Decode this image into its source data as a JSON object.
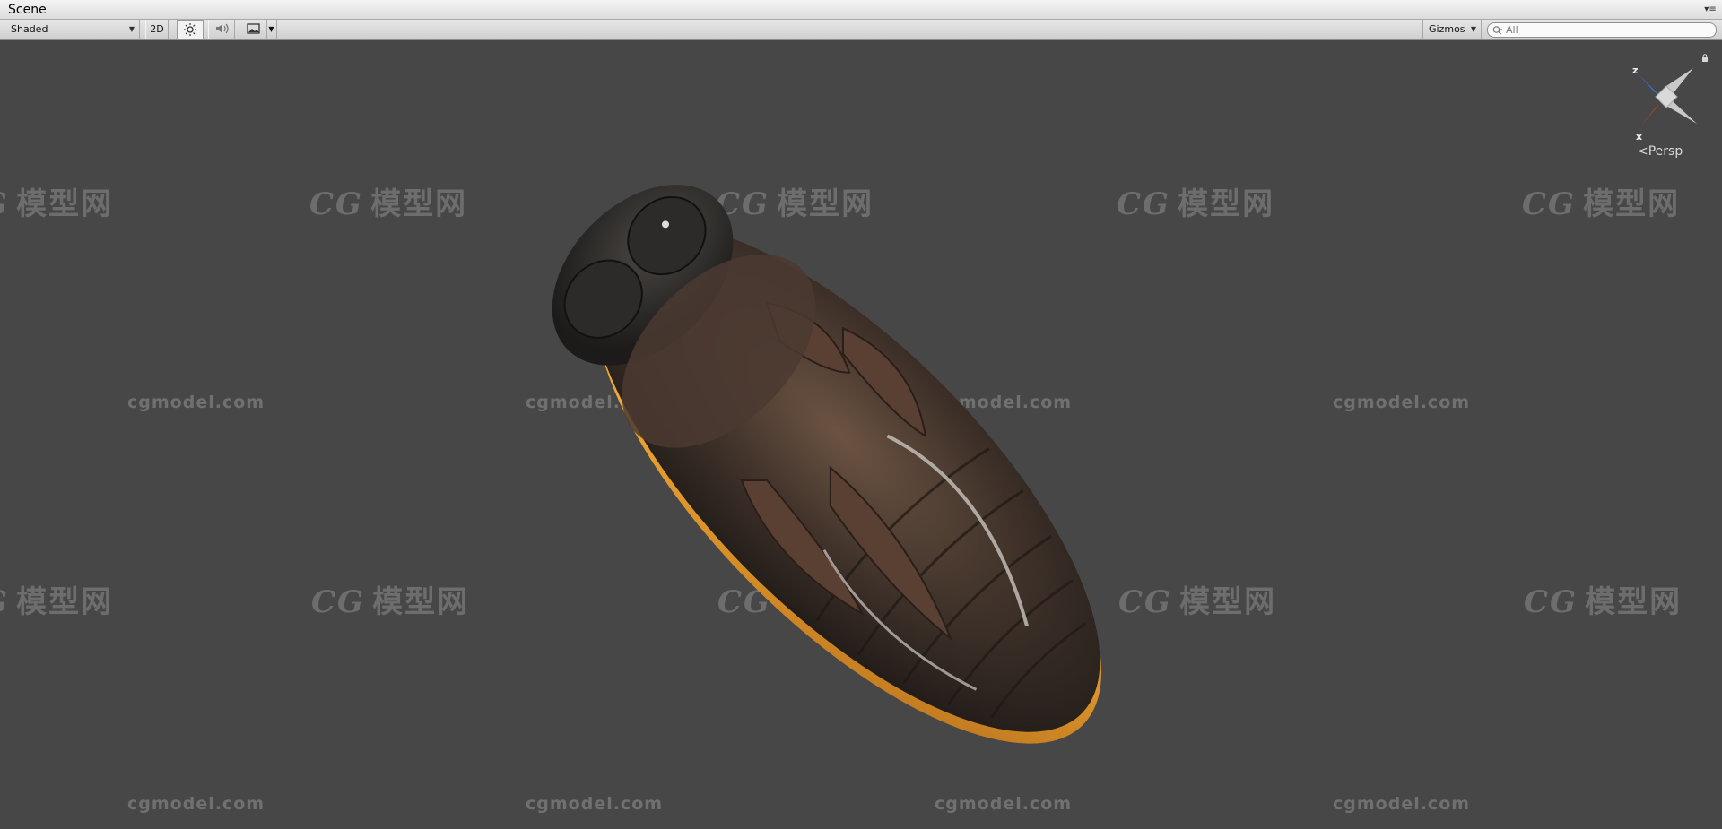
{
  "window": {
    "title": "Scene",
    "menu_icon": "hamburger-icon"
  },
  "toolbar": {
    "render_mode": "Shaded",
    "mode_2d_label": "2D",
    "lighting_icon": "sun-icon",
    "audio_icon": "speaker-icon",
    "effects_icon": "image-icon",
    "gizmos_label": "Gizmos",
    "search_placeholder": "All"
  },
  "viewport": {
    "projection_label": "<Persp",
    "axis_labels": {
      "x": "x",
      "z": "z"
    },
    "axis_colors": {
      "x": "#e8401f",
      "y": "#9bd14b",
      "z": "#3a6fe0"
    },
    "background": "#474747",
    "model_highlight": "#f2a32a"
  },
  "watermarks": {
    "site": "cgmodel.com",
    "logo_cg": "CG",
    "logo_text": "模型网"
  }
}
